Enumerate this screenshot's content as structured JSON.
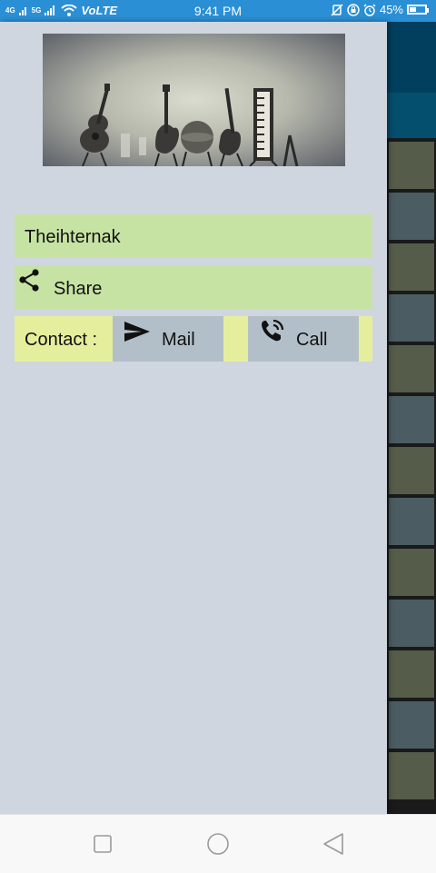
{
  "status_bar": {
    "network_tags": [
      "4G",
      "5G"
    ],
    "volte": "VoLTE",
    "time": "9:41 PM",
    "battery": "45%",
    "battery_level": 0.45
  },
  "drawer": {
    "header_image": "musical-instruments-photo",
    "name_item": "Theihternak",
    "share_item": "Share",
    "contact": {
      "label": "Contact :",
      "mail_label": "Mail",
      "call_label": "Call"
    }
  },
  "icons": {
    "share": "share-icon",
    "mail": "send-icon",
    "call": "phone-call-icon"
  },
  "background_tiles": {
    "colors": [
      "#555d4a",
      "#4b5d63"
    ]
  },
  "colors": {
    "status_bar": "#2a8fd4",
    "drawer_bg": "#cfd6df",
    "list_item_bg": "#c6e3a3",
    "contact_bg": "#e5ee9c",
    "button_bg": "#b3bfc8"
  }
}
